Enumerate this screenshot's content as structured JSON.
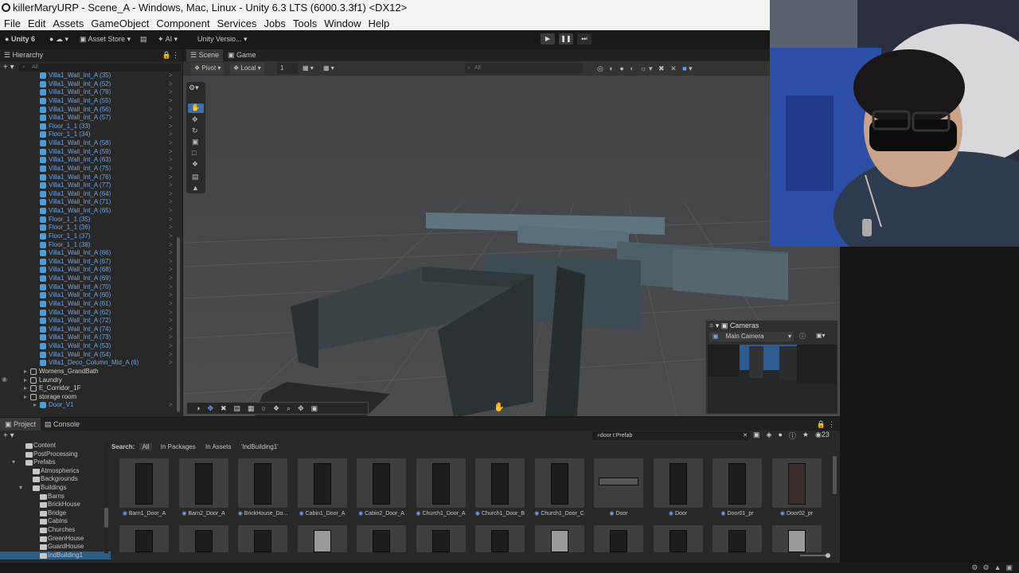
{
  "window": {
    "title": "killerMaryURP - Scene_A - Windows, Mac, Linux - Unity 6.3 LTS (6000.3.3f1) <DX12>"
  },
  "menu": [
    "File",
    "Edit",
    "Assets",
    "GameObject",
    "Component",
    "Services",
    "Jobs",
    "Tools",
    "Window",
    "Help"
  ],
  "toolbar": {
    "unity_label": "Unity 6",
    "asset_store": "Asset Store",
    "ai": "AI",
    "version_control": "Unity Versio..."
  },
  "hierarchy": {
    "tab": "Hierarchy",
    "search_placeholder": "All",
    "items": [
      {
        "label": "Villa1_Wall_Int_A (35)",
        "type": "prefab"
      },
      {
        "label": "Villa1_Wall_Int_A (52)",
        "type": "prefab"
      },
      {
        "label": "Villa1_Wall_Int_A (78)",
        "type": "prefab"
      },
      {
        "label": "Villa1_Wall_Int_A (55)",
        "type": "prefab"
      },
      {
        "label": "Villa1_Wall_Int_A (56)",
        "type": "prefab"
      },
      {
        "label": "Villa1_Wall_Int_A (57)",
        "type": "prefab"
      },
      {
        "label": "Floor_1_1 (33)",
        "type": "prefab"
      },
      {
        "label": "Floor_1_1 (34)",
        "type": "prefab"
      },
      {
        "label": "Villa1_Wall_Int_A (58)",
        "type": "prefab"
      },
      {
        "label": "Villa1_Wall_Int_A (59)",
        "type": "prefab"
      },
      {
        "label": "Villa1_Wall_Int_A (63)",
        "type": "prefab"
      },
      {
        "label": "Villa1_Wall_Int_A (75)",
        "type": "prefab"
      },
      {
        "label": "Villa1_Wall_Int_A (76)",
        "type": "prefab"
      },
      {
        "label": "Villa1_Wall_Int_A (77)",
        "type": "prefab"
      },
      {
        "label": "Villa1_Wall_Int_A (64)",
        "type": "prefab"
      },
      {
        "label": "Villa1_Wall_Int_A (71)",
        "type": "prefab"
      },
      {
        "label": "Villa1_Wall_Int_A (65)",
        "type": "prefab"
      },
      {
        "label": "Floor_1_1 (35)",
        "type": "prefab"
      },
      {
        "label": "Floor_1_1 (36)",
        "type": "prefab"
      },
      {
        "label": "Floor_1_1 (37)",
        "type": "prefab"
      },
      {
        "label": "Floor_1_1 (38)",
        "type": "prefab"
      },
      {
        "label": "Villa1_Wall_Int_A (66)",
        "type": "prefab"
      },
      {
        "label": "Villa1_Wall_Int_A (67)",
        "type": "prefab"
      },
      {
        "label": "Villa1_Wall_Int_A (68)",
        "type": "prefab"
      },
      {
        "label": "Villa1_Wall_Int_A (69)",
        "type": "prefab"
      },
      {
        "label": "Villa1_Wall_Int_A (70)",
        "type": "prefab"
      },
      {
        "label": "Villa1_Wall_Int_A (60)",
        "type": "prefab"
      },
      {
        "label": "Villa1_Wall_Int_A (61)",
        "type": "prefab"
      },
      {
        "label": "Villa1_Wall_Int_A (62)",
        "type": "prefab"
      },
      {
        "label": "Villa1_Wall_Int_A (72)",
        "type": "prefab"
      },
      {
        "label": "Villa1_Wall_Int_A (74)",
        "type": "prefab"
      },
      {
        "label": "Villa1_Wall_Int_A (73)",
        "type": "prefab"
      },
      {
        "label": "Villa1_Wall_Int_A (53)",
        "type": "prefab"
      },
      {
        "label": "Villa1_Wall_Int_A (54)",
        "type": "prefab"
      },
      {
        "label": "Villa1_Deco_Column_Mid_A (6)",
        "type": "prefab"
      },
      {
        "label": "Womens_GrandBath",
        "type": "object"
      },
      {
        "label": "Laundry",
        "type": "object"
      },
      {
        "label": "E_Corridor_1F",
        "type": "object"
      },
      {
        "label": "storage room",
        "type": "object"
      },
      {
        "label": "Door_V1",
        "type": "prefab-root"
      }
    ]
  },
  "scene": {
    "tabs": [
      "Scene",
      "Game"
    ],
    "pivot": "Pivot",
    "local": "Local",
    "grid_value": "1",
    "search_placeholder": "All"
  },
  "cameras_overlay": {
    "title": "Cameras",
    "selected": "Main Camera"
  },
  "project": {
    "tabs": [
      "Project",
      "Console"
    ],
    "search_value": "door t:Prefab",
    "count": "23",
    "search_label": "Search:",
    "search_scopes": [
      "All",
      "In Packages",
      "In Assets",
      "'IndBuilding1'"
    ],
    "folders": [
      {
        "label": "Content",
        "depth": 1
      },
      {
        "label": "PostProcessing",
        "depth": 1
      },
      {
        "label": "Prefabs",
        "depth": 1,
        "open": true
      },
      {
        "label": "Atmospherics",
        "depth": 2
      },
      {
        "label": "Backgrounds",
        "depth": 2
      },
      {
        "label": "Buildings",
        "depth": 2,
        "open": true
      },
      {
        "label": "Barns",
        "depth": 3
      },
      {
        "label": "BrickHouse",
        "depth": 3
      },
      {
        "label": "Bridge",
        "depth": 3
      },
      {
        "label": "Cabins",
        "depth": 3
      },
      {
        "label": "Churches",
        "depth": 3
      },
      {
        "label": "GreenHouse",
        "depth": 3
      },
      {
        "label": "GuardHouse",
        "depth": 3
      },
      {
        "label": "IndBuilding1",
        "depth": 3,
        "selected": true
      }
    ],
    "assets": [
      "Barn1_Door_A",
      "Barn2_Door_A",
      "BrickHouse_Do...",
      "Cabin1_Door_A",
      "Cabin2_Door_A",
      "Church1_Door_A",
      "Church1_Door_B",
      "Church1_Door_C",
      "Door",
      "Door",
      "Door01_pr",
      "Door02_pr"
    ]
  }
}
